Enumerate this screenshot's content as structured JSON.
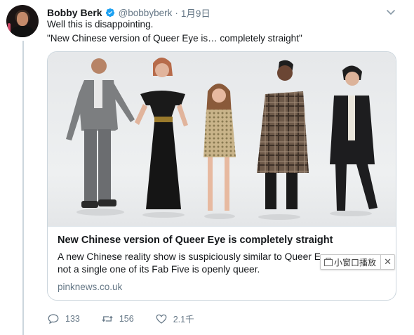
{
  "tweet": {
    "author_name": "Bobby Berk",
    "handle": "@bobbyberk",
    "separator": "·",
    "date": "1月9日",
    "text_line1": "Well this is disappointing.",
    "text_line2": "\"New Chinese version of Queer Eye is… completely straight\""
  },
  "card": {
    "title": "New Chinese version of Queer Eye is completely straight",
    "description": "A new Chinese reality show is suspiciously similar to Queer E… and not a single one of its Fab Five is openly queer.",
    "description_line1": "A new Chinese reality show is suspiciously similar to Queer E",
    "description_line2": "not a single one of its Fab Five is openly queer.",
    "domain": "pinknews.co.uk"
  },
  "overlay": {
    "mini_window_label": "小窗口播放",
    "close_glyph": "✕"
  },
  "actions": {
    "replies": "133",
    "retweets": "156",
    "likes": "2.1千"
  },
  "colors": {
    "verified_blue": "#1da1f2",
    "muted_text": "#657786",
    "border": "#ccd6dd"
  },
  "icons": [
    "verified-badge-icon",
    "caret-down-icon",
    "reply-icon",
    "retweet-icon",
    "like-icon",
    "mini-window-icon",
    "close-icon"
  ]
}
